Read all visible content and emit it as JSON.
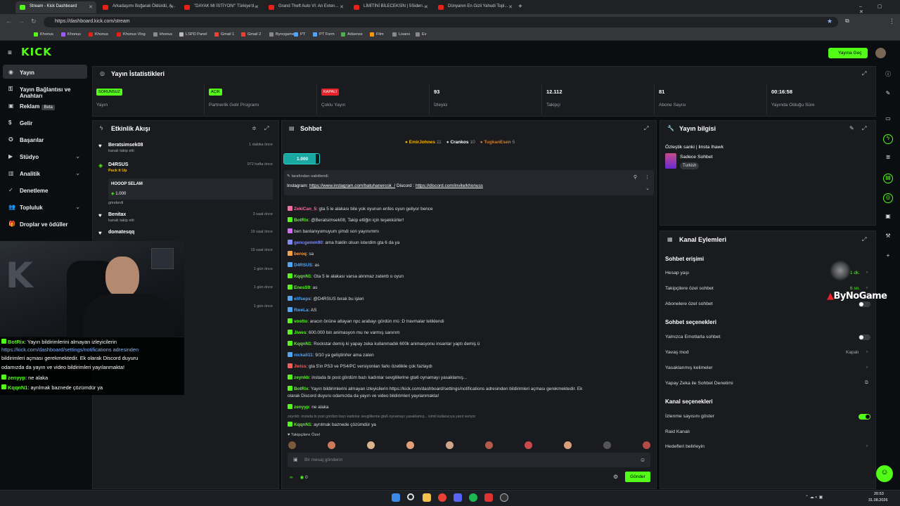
{
  "browser": {
    "tabs": [
      {
        "title": "Stream - Kick Dashboard",
        "active": true
      },
      {
        "title": "Arkadaşımı Boğarak Öldürdü, A..."
      },
      {
        "title": "\"DAYAK MI İSTİYON!\" Türkiye'd..."
      },
      {
        "title": "Grand Theft Auto VI: An Exten..."
      },
      {
        "title": "LİMİTİNİ BİLECEKSİN | 5Siderı..."
      },
      {
        "title": "Dünyanın En Gizli Yahudi Topl..."
      }
    ],
    "url": "https://dashboard.kick.com/stream",
    "bookmarks": [
      "Khonus",
      "Khonus",
      "Khonus",
      "Khonus Vlog",
      "khonus",
      "LSPD Panel",
      "Gmail 1",
      "Gmail 2",
      "Bynogame",
      "PT",
      "PT Form",
      "Adsense",
      "Film",
      "Lisans",
      "Ev"
    ]
  },
  "header": {
    "logo": "KICK",
    "go_live": "Yayına Geç"
  },
  "sidebar": {
    "items": [
      {
        "label": "Yayın",
        "active": true
      },
      {
        "label": "Yayın Bağlantısı ve Anahtarı"
      },
      {
        "label": "Reklam",
        "badge": "Beta"
      },
      {
        "label": "Gelir"
      },
      {
        "label": "Başarılar"
      },
      {
        "label": "Stüdyo",
        "expandable": true
      },
      {
        "label": "Analitik",
        "expandable": true
      },
      {
        "label": "Denetleme"
      },
      {
        "label": "Topluluk",
        "expandable": true
      },
      {
        "label": "Droplar ve ödüller"
      }
    ]
  },
  "stats": {
    "title": "Yayın İstatistikleri",
    "items": [
      {
        "badge": "SORUNSUZ",
        "label": "Yayın",
        "badge_color": "#53fc18"
      },
      {
        "badge": "AÇIK",
        "label": "Partnerlik Gelir Programı",
        "badge_color": "#53fc18"
      },
      {
        "badge": "KAPALI",
        "label": "Çoklu Yayın",
        "badge_color": "#e8212a"
      },
      {
        "value": "93",
        "label": "İzleyici"
      },
      {
        "value": "12.112",
        "label": "Takipçi"
      },
      {
        "value": "81",
        "label": "Abone Sayısı"
      },
      {
        "value": "00:16:58",
        "label": "Yayında Olduğu Süre"
      }
    ]
  },
  "events": {
    "title": "Etkinlik Akışı",
    "items": [
      {
        "name": "Beratsimsek08",
        "sub": "kanalı takip etti",
        "time": "1 dakika önce"
      },
      {
        "name": "D4RSUS",
        "sub": "Pack It Up",
        "time": "972 hafta önce",
        "message": "HOOOP SELAM",
        "amount": "1.000",
        "footer": "gönderdi"
      },
      {
        "name": "Benitax",
        "sub": "kanalı takip etti",
        "time": "3 saat önce"
      },
      {
        "name": "domatesqq",
        "sub": "",
        "time": "19 saat önce"
      },
      {
        "time": "19 saat önce"
      },
      {
        "time": "1 gün önce"
      },
      {
        "time": "1 gün önce"
      },
      {
        "time": "1 gün önce"
      }
    ]
  },
  "chat": {
    "title": "Sohbet",
    "top_gifters": [
      {
        "name": "EmirJohnes",
        "count": "11"
      },
      {
        "name": "Crankos",
        "count": "10"
      },
      {
        "name": "TugkanEsen",
        "count": "5"
      }
    ],
    "kicks_pill": "1.000",
    "pinned": {
      "by": "tarafından sabitlendi",
      "text_prefix": "Instagram: ",
      "instagram": "https://www.instagram.com/batuhanercok_/",
      "mid": " Discord : ",
      "discord": "https://discord.com/invite/khonuss"
    },
    "messages": [
      {
        "user": "ZekiCan_5",
        "color": "#ff6b9a",
        "text": "gta 5 le alakası bile yok oyunun enfes oyun geliyor bence"
      },
      {
        "user": "BotRix",
        "color": "#53fc18",
        "text": "@Beratsimsek08, Takip ettiğin için teşekkürler!"
      },
      {
        "user": "",
        "color": "#d46bff",
        "text": "ben banlanıyomuyum şimdi son yayınımmı"
      },
      {
        "user": "gencgemm90",
        "color": "#7e8bff",
        "text": "ama fraklin olsun isterdim gta 6 da ya"
      },
      {
        "user": "beroq",
        "color": "#ff9f43",
        "text": "sa"
      },
      {
        "user": "D4RSUS",
        "color": "#4da6ff",
        "text": "as"
      },
      {
        "user": "KqqnN1",
        "color": "#53fc18",
        "text": "Gta 5 le alakası varsa alınmaz zatenb o oyun"
      },
      {
        "user": "EnesS9",
        "color": "#53fc18",
        "text": "as"
      },
      {
        "user": "elifseps",
        "color": "#4da6ff",
        "text": "@D4RSUS bırak bu işleri"
      },
      {
        "user": "RweLa",
        "color": "#4da6ff",
        "text": "AS"
      },
      {
        "user": "vostto",
        "color": "#53fc18",
        "text": "aracın önüne atlayan npc arabayı gördün mü :D travmalar tetiklendi"
      },
      {
        "user": "Jiwes",
        "color": "#53fc18",
        "text": "600.000 bin animasyon mu ne varmış sanırım"
      },
      {
        "user": "KqqnN1",
        "color": "#53fc18",
        "text": "Rockstar demiş ki yapay zeka kullanmadık 600k animasyonu insanlar yaptı demiş ü"
      },
      {
        "user": "nickali11",
        "color": "#4da6ff",
        "text": "9/10 ya geliştirirler ama zaten"
      },
      {
        "user": "Jwiss",
        "color": "#ff5a5a",
        "text": "gta 5'in PS3 ve PS4/PC versiyonları farkı özellikle çok fazlaydı"
      },
      {
        "user": "zeynkb",
        "color": "#53fc18",
        "text": "instada bi post gördüm bazı kadınlar sevgililerine gta6 oynamayı yasaklamış..."
      },
      {
        "user": "BotRix",
        "color": "#53fc18",
        "text": "Yayın bildirimlerini almayan izleyicilerin https://kick.com/dashboard/settings/notifications adresinden bildirimleri açması gerekmektedir. Ek"
      },
      {
        "user": "",
        "color": "#ddd",
        "text": "olarak Discord duyuru odamızda da yayın ve video bildirimleri yayılanmakta!"
      },
      {
        "user": "zenyyp",
        "color": "#53fc18",
        "text": "ne alaka"
      },
      {
        "user": "",
        "color": "#888",
        "text": "zeynkb: instada bi post gördüm bazı kadınlar sevgililerine gta6 oynamayı yasaklamış... isimli kullanıcıya yanıt veriyor"
      },
      {
        "user": "KqqnN1",
        "color": "#53fc18",
        "text": "ayrılmak baznede çözümdür ya"
      }
    ],
    "followers_only": "Takipçilere Özel",
    "input_placeholder": "Bir mesaj gönderin",
    "viewer_count": "0",
    "send_label": "Gönder"
  },
  "stream_info": {
    "title": "Yayın bilgisi",
    "stream_title": "Özleştik sanki | linsta Ihawk",
    "category": "Sadece Sohbet",
    "tag": "Turkish"
  },
  "channel_actions": {
    "title": "Kanal Eylemleri",
    "chat_access_heading": "Sohbet erişimi",
    "account_age": {
      "label": "Hesap yaşı",
      "value": "1 dk."
    },
    "followers_chat": {
      "label": "Takipçilere özel sohbet",
      "value": "6 sn."
    },
    "subs_chat": {
      "label": "Abonelere özel sohbet"
    },
    "chat_options_heading": "Sohbet seçenekleri",
    "emote_only": {
      "label": "Yalnızca Emotlarla sohbet"
    },
    "slow_mode": {
      "label": "Yavaş mod",
      "value": "Kapalı"
    },
    "banned_words": {
      "label": "Yasaklanmış kelimeler"
    },
    "ai_moderation": {
      "label": "Yapay Zeka ile Sohbet Denetimi"
    },
    "channel_options_heading": "Kanal seçenekleri",
    "viewer_count": {
      "label": "İzlenme sayısını göster"
    },
    "raid": {
      "label": "Raid Kanalı"
    },
    "goals": {
      "label": "Hedefleri belirleyin"
    }
  },
  "overlay": {
    "watermark": "ByNoGame",
    "webcam_chat": [
      {
        "user": "BotRix",
        "text": "Yayın bildirimlerini almayan izleyicilerin"
      },
      {
        "text": "https://kick.com/dashboard/settings/notifications adresinden"
      },
      {
        "text": "bildirimleri açması gerekmektedir. Ek olarak Discord duyuru"
      },
      {
        "text": "odamızda da yayın ve video bildirimleri yayılanmakta!"
      },
      {
        "user": "zenyyp",
        "text": "ne alaka"
      },
      {
        "user": "KqqnN1",
        "text": "ayrılmak baznede çözümdür ya"
      }
    ]
  },
  "taskbar": {
    "time": "20:53",
    "date": "31.08.2026"
  }
}
